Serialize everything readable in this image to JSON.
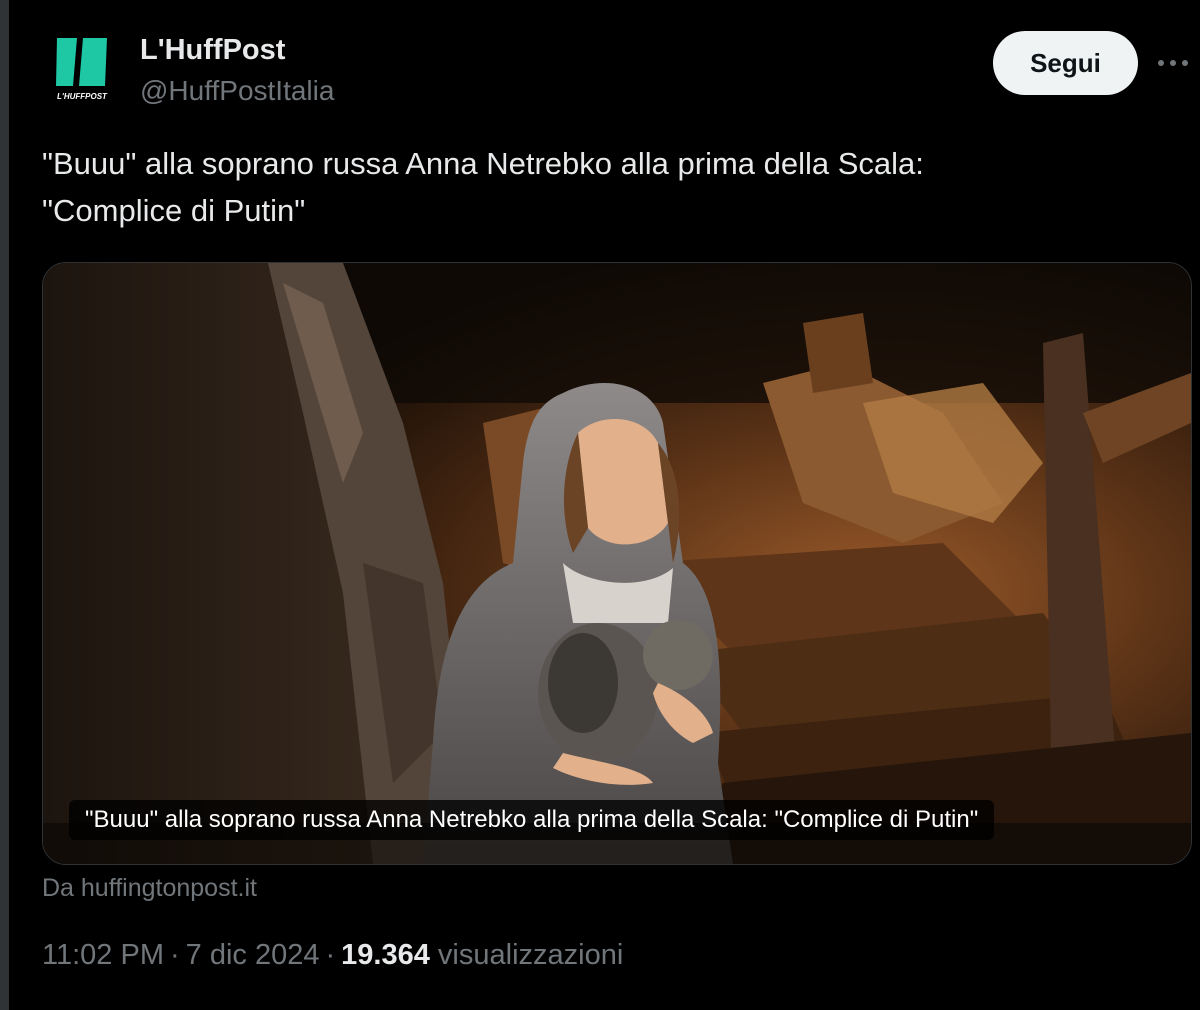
{
  "author": {
    "display_name": "L'HuffPost",
    "handle": "@HuffPostItalia",
    "avatar_icon": "huffpost-logo-icon",
    "avatar_logo_text": "L'HUFFPOST",
    "brand_color": "#1ec8a5"
  },
  "actions": {
    "follow_label": "Segui",
    "more_icon": "more-horizontal-icon"
  },
  "tweet": {
    "text": "\"Buuu\" alla soprano russa Anna Netrebko alla prima della Scala:\n\"Complice di Putin\""
  },
  "media_card": {
    "caption": "\"Buuu\" alla soprano russa Anna Netrebko alla prima della Scala: \"Complice di Putin\"",
    "source": "Da huffingtonpost.it"
  },
  "meta": {
    "time": "11:02 PM",
    "separator": "·",
    "date": "7 dic 2024",
    "views_count": "19.364",
    "views_label": "visualizzazioni"
  },
  "colors": {
    "background": "#000000",
    "text_primary": "#e7e9ea",
    "text_secondary": "#71767b",
    "border": "#2f3336",
    "button_bg": "#eff3f4"
  }
}
